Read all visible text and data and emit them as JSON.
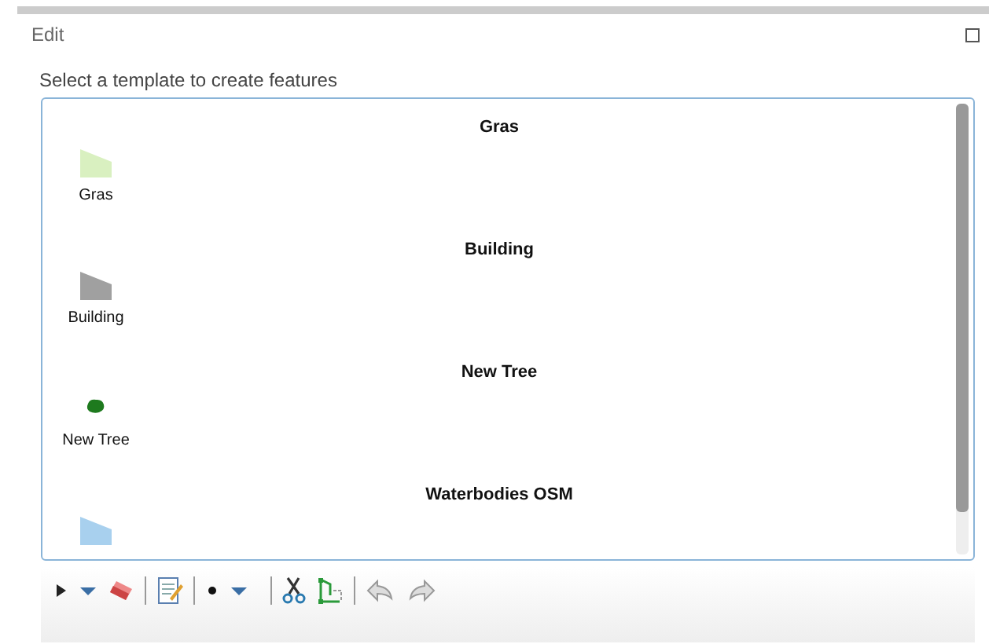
{
  "panel": {
    "title": "Edit"
  },
  "prompt": "Select a template to create features",
  "groups": [
    {
      "title": "Gras",
      "items": [
        {
          "label": "Gras",
          "kind": "polygon",
          "color": "#d9f0c0"
        }
      ]
    },
    {
      "title": "Building",
      "items": [
        {
          "label": "Building",
          "kind": "polygon",
          "color": "#a0a0a0"
        }
      ]
    },
    {
      "title": "New Tree",
      "items": [
        {
          "label": "New Tree",
          "kind": "point",
          "color": "#1e7a1e"
        }
      ]
    },
    {
      "title": "Waterbodies OSM",
      "items": [
        {
          "kind": "polygon",
          "color": "#a8d0ee"
        }
      ]
    }
  ]
}
